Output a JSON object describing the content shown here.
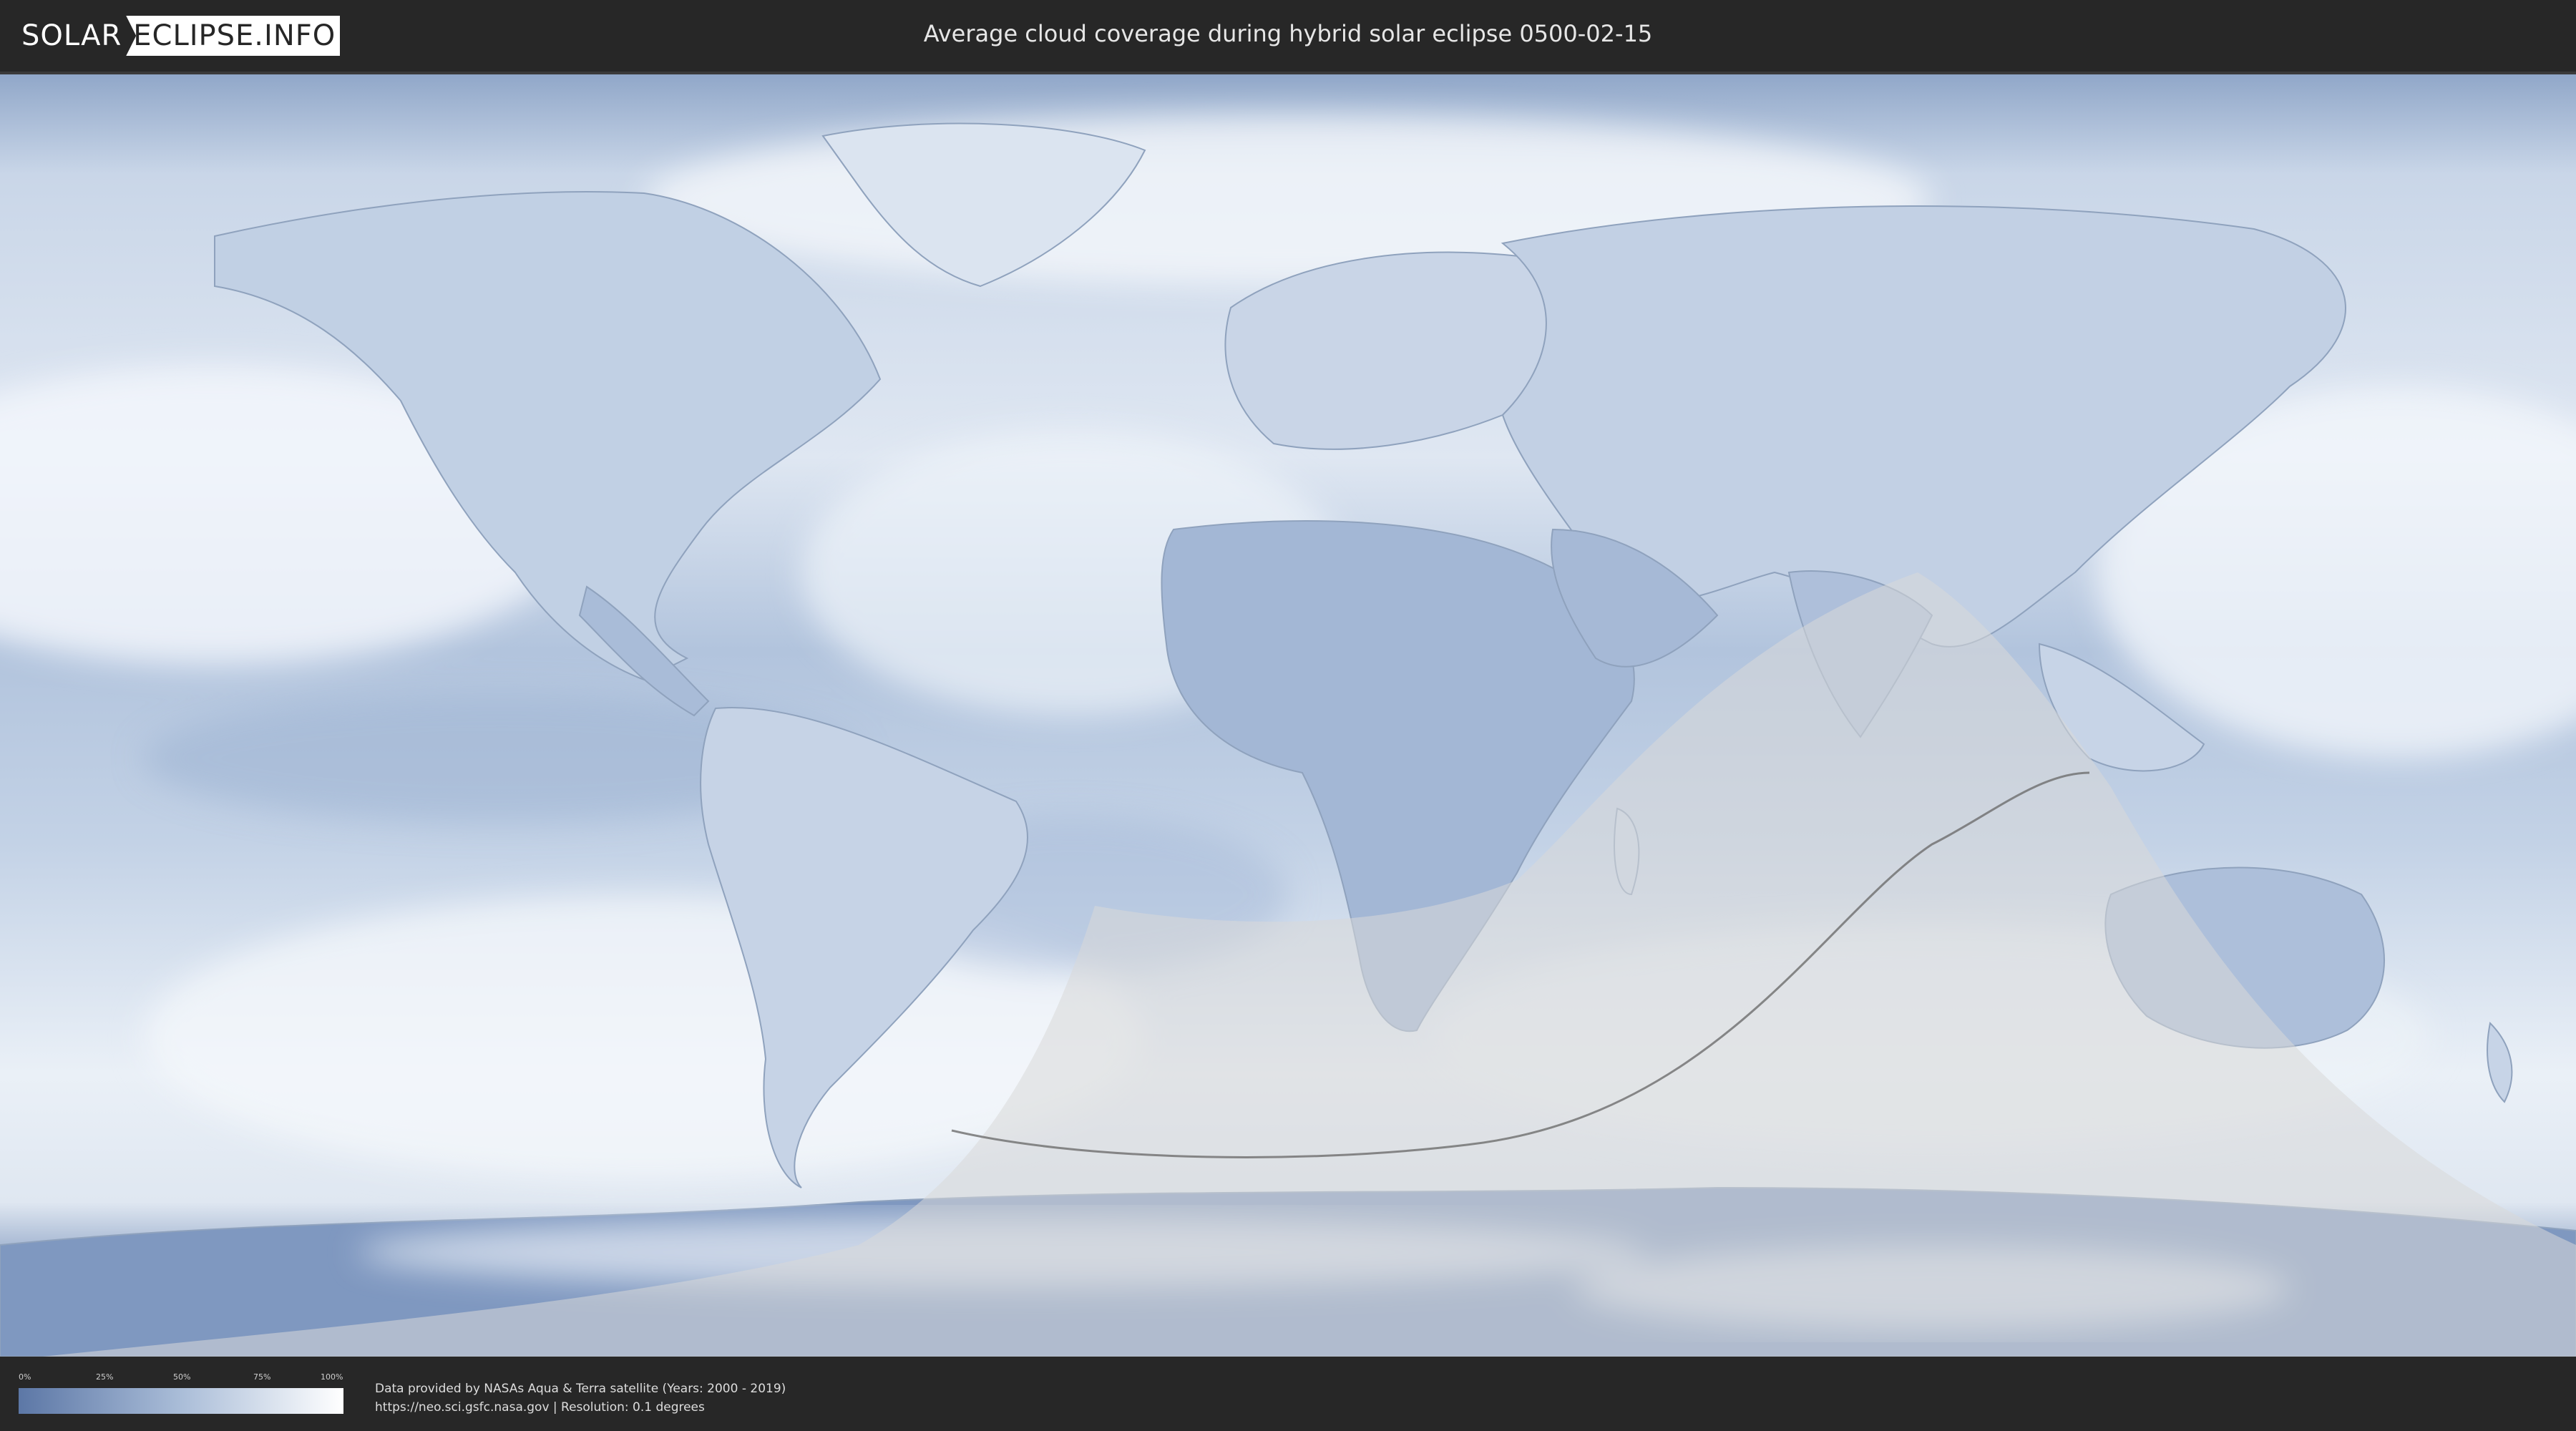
{
  "header": {
    "logo_left": "SOLAR",
    "logo_right": "ECLIPSE.INFO",
    "title": "Average cloud coverage during hybrid solar eclipse 0500-02-15"
  },
  "legend": {
    "ticks": [
      "0%",
      "25%",
      "50%",
      "75%",
      "100%"
    ],
    "colors": {
      "low": "#5c77a6",
      "mid": "#aabdd8",
      "high": "#ffffff"
    }
  },
  "footer": {
    "source_line1": "Data provided by NASAs Aqua & Terra satellite (Years: 2000 - 2019)",
    "source_line2": "https://neo.sci.gsfc.nasa.gov | Resolution: 0.1 degrees"
  },
  "map": {
    "ocean_color": "#a9bfda",
    "cloud_color": "#f4f7fb",
    "shadow_color": "#d9d9d9"
  }
}
